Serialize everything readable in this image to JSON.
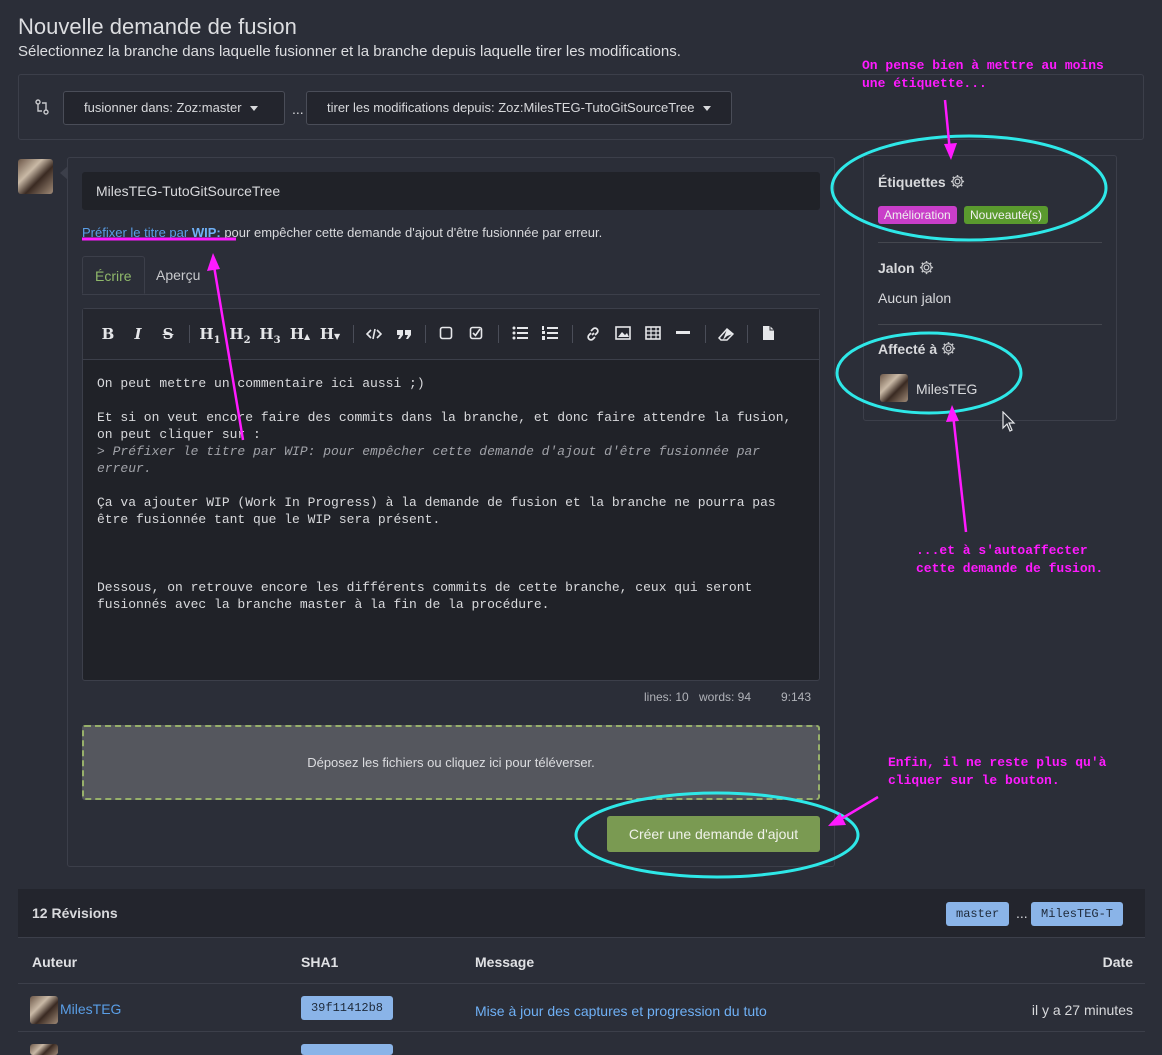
{
  "page": {
    "title": "Nouvelle demande de fusion",
    "subtitle": "Sélectionnez la branche dans laquelle fusionner et la branche depuis laquelle tirer les modifications."
  },
  "branches": {
    "base_label": "fusionner dans: Zoz:master",
    "separator": "...",
    "head_label": "tirer les modifications depuis: Zoz:MilesTEG-TutoGitSourceTree"
  },
  "form": {
    "title_value": "MilesTEG-TutoGitSourceTree",
    "wip_link": "Préfixer le titre par",
    "wip_keyword": "WIP:",
    "wip_text": " pour empêcher cette demande d'ajout d'être fusionnée par erreur.",
    "tab_write": "Écrire",
    "tab_preview": "Aperçu",
    "toolbar": {
      "bold": "B",
      "italic": "I",
      "strike": "S",
      "h1": "H",
      "h1_sub": "1",
      "h2": "H",
      "h2_sub": "2",
      "h3": "H",
      "h3_sub": "3",
      "h_bigger": "H",
      "h_smaller": "H"
    },
    "body_line1": "On peut mettre un commentaire ici aussi ;)",
    "body_line2": "Et si on veut encore faire des commits dans la branche, et donc faire attendre la fusion, on peut cliquer sur :",
    "body_quote": "> Préfixer le titre par WIP: pour empêcher cette demande d'ajout d'être fusionnée par erreur.",
    "body_line3": "Ça va ajouter WIP (Work In Progress) à la demande de fusion et la branche ne pourra pas être fusionnée tant que le WIP sera présent.",
    "body_line4": "Dessous, on retrouve encore les différents commits de cette branche, ceux qui seront fusionnés avec la branche master à la fin de la procédure.",
    "status_lines": "lines: 10",
    "status_words": "words: 94",
    "status_cursor": "9:143",
    "dropzone_text": "Déposez les fichiers ou cliquez ici pour téléverser.",
    "submit_label": "Créer une demande d'ajout"
  },
  "sidebar": {
    "labels_heading": "Étiquettes",
    "labels": [
      {
        "name": "Amélioration",
        "color": "#c93ec9"
      },
      {
        "name": "Nouveauté(s)",
        "color": "#5a9a2e"
      }
    ],
    "milestone_heading": "Jalon",
    "milestone_value": "Aucun jalon",
    "assignee_heading": "Affecté à",
    "assignee_name": "MilesTEG"
  },
  "annotations": {
    "note_labels_1": "On pense bien à mettre au moins",
    "note_labels_2": "une étiquette...",
    "note_assign_1": "...et à s'autoaffecter",
    "note_assign_2": "cette demande de fusion.",
    "note_button_1": "Enfin, il ne reste plus qu'à",
    "note_button_2": "cliquer sur le bouton.",
    "color": "#ff1aff",
    "ellipse_color": "#2ee8e8"
  },
  "revisions": {
    "title": "12 Révisions",
    "ref_base": "master",
    "ref_dots": "...",
    "ref_head": "MilesTEG-T",
    "columns": [
      "Auteur",
      "SHA1",
      "Message",
      "Date"
    ],
    "rows": [
      {
        "author": "MilesTEG",
        "sha": "39f11412b8",
        "message": "Mise à jour des captures et progression du tuto",
        "date": "il y a 27 minutes"
      }
    ]
  }
}
